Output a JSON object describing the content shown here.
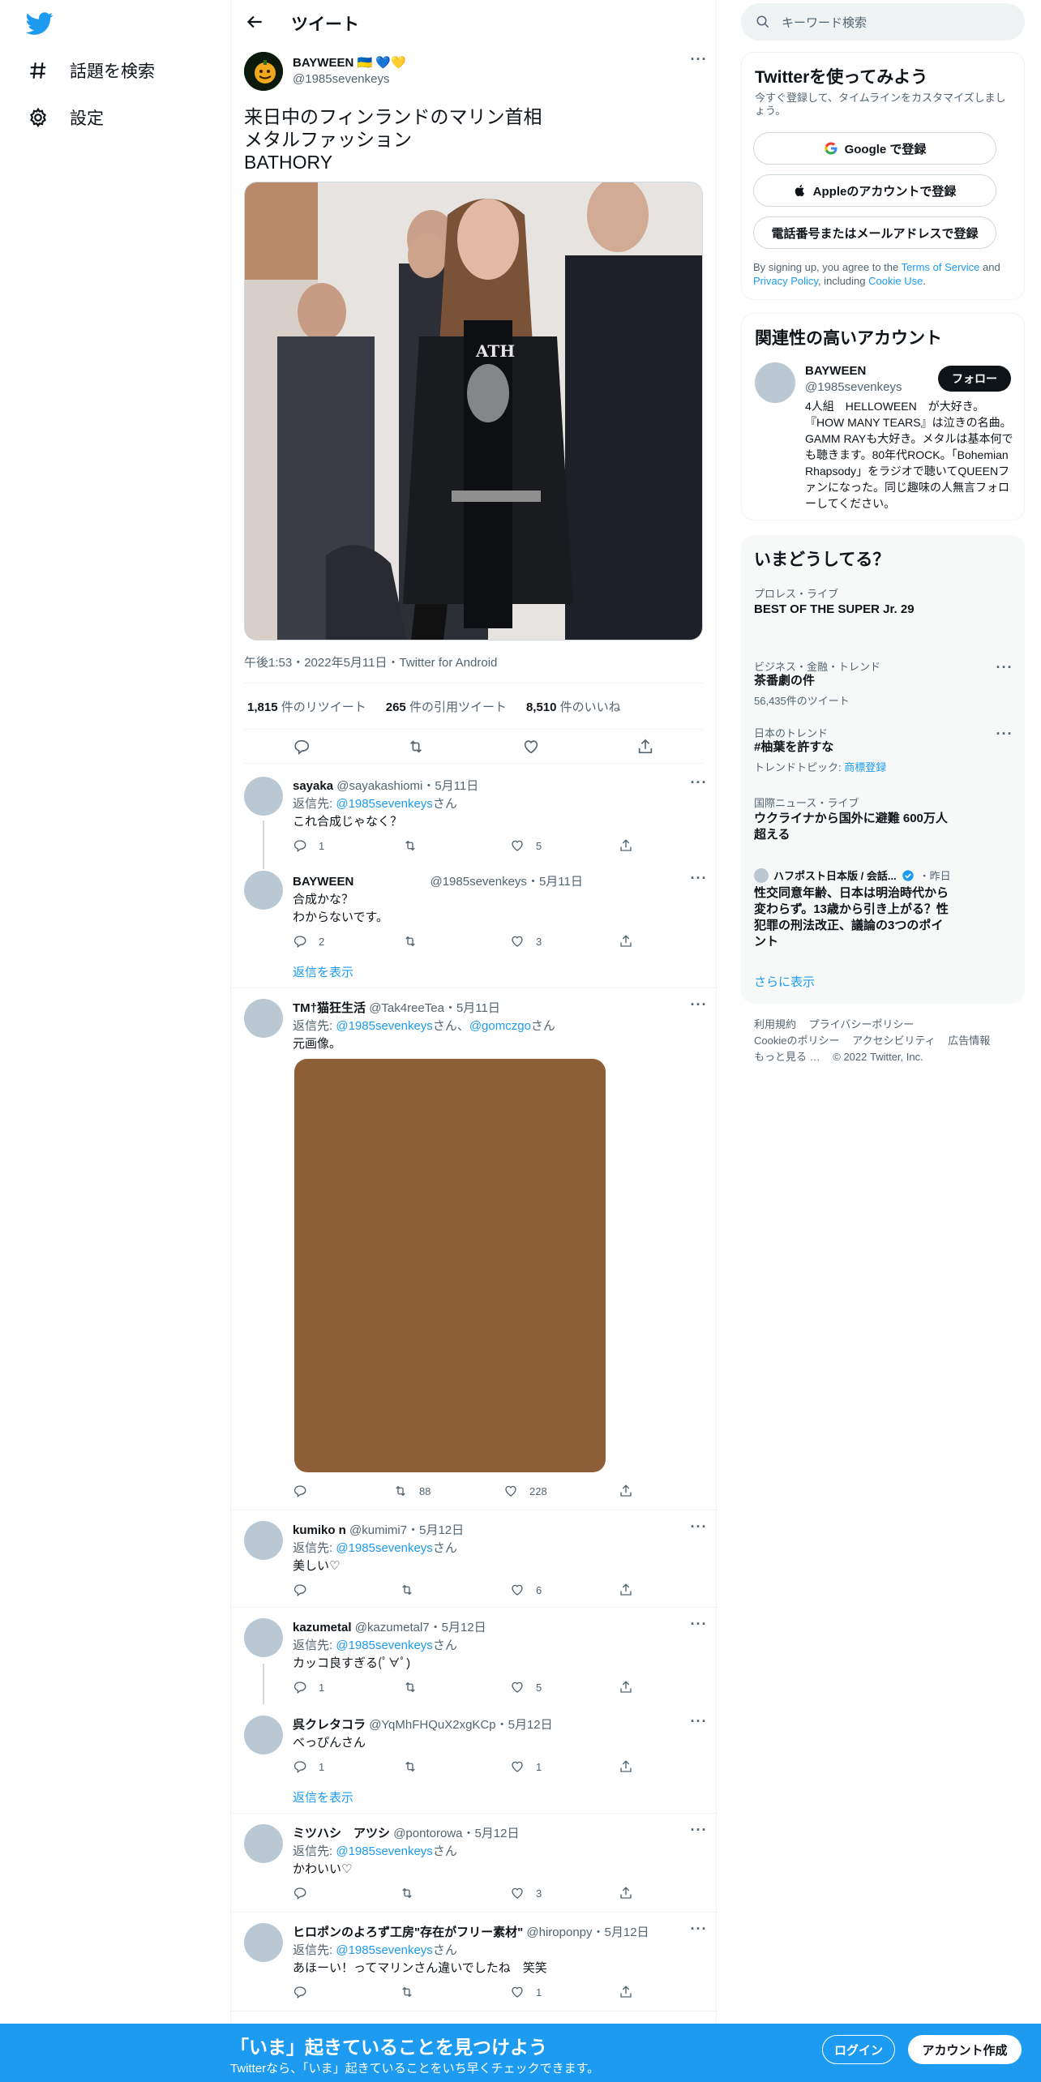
{
  "nav": {
    "explore_label": "話題を検索",
    "settings_label": "設定"
  },
  "header": {
    "title": "ツイート"
  },
  "main_tweet": {
    "author_name": "BAYWEEN 🇺🇦 💙💛",
    "author_handle": "@1985sevenkeys",
    "text": "来日中のフィンランドのマリン首相\nメタルファッション\nBATHORY",
    "meta": "午後1:53・2022年5月11日・Twitter for Android",
    "retweets": "1,815",
    "retweets_label": "件のリツイート",
    "quotes": "265",
    "quotes_label": "件の引用ツイート",
    "likes": "8,510",
    "likes_label": "件のいいね"
  },
  "replies": [
    {
      "name": "sayaka",
      "handle": "@sayakashiomi",
      "date": "・5月11日",
      "reply_to_label": "返信先: ",
      "reply_to": "@1985sevenkeys",
      "reply_suffix": "さん",
      "text": "これ合成じゃなく？",
      "reply_count": "1",
      "retweet_count": "",
      "like_count": "5"
    },
    {
      "name": "BAYWEEN",
      "handle": "@1985sevenkeys",
      "date": "・5月11日",
      "text1": "合成かな？",
      "text2": "わからないです。",
      "reply_count": "2",
      "retweet_count": "",
      "like_count": "3"
    },
    {
      "name": "TM†猫狂生活",
      "handle": "@Tak4reeTea",
      "date": "・5月11日",
      "reply_to_label": "返信先: ",
      "reply_to": "@1985sevenkeys",
      "reply_mid": "さん、",
      "reply_to2": "@gomczgo",
      "reply_suffix": "さん",
      "text": "元画像。",
      "reply_count": "",
      "retweet_count": "88",
      "like_count": "228"
    },
    {
      "name": "kumiko n",
      "handle": "@kumimi7",
      "date": "・5月12日",
      "reply_to_label": "返信先: ",
      "reply_to": "@1985sevenkeys",
      "reply_suffix": "さん",
      "text": "美しい♡",
      "reply_count": "",
      "retweet_count": "",
      "like_count": "6"
    },
    {
      "name": "kazumetal",
      "handle": "@kazumetal7",
      "date": "・5月12日",
      "reply_to_label": "返信先: ",
      "reply_to": "@1985sevenkeys",
      "reply_suffix": "さん",
      "text": "カッコ良すぎる(ﾟ∀ﾟ)",
      "reply_count": "1",
      "retweet_count": "",
      "like_count": "5"
    },
    {
      "name": "呉クレタコラ",
      "handle": "@YqMhFHQuX2xgKCp",
      "date": "・5月12日",
      "text": "べっぴんさん",
      "reply_count": "1",
      "retweet_count": "",
      "like_count": "1"
    },
    {
      "name": "ミツハシ　アツシ",
      "handle": "@pontorowa",
      "date": "・5月12日",
      "reply_to_label": "返信先: ",
      "reply_to": "@1985sevenkeys",
      "reply_suffix": "さん",
      "text": "かわいい♡",
      "reply_count": "",
      "retweet_count": "",
      "like_count": "3"
    },
    {
      "name": "ヒロポンのよろず工房\"存在がフリー素材\"",
      "handle": "@hiroponpy",
      "date": "・5月12日",
      "reply_to_label": "返信先: ",
      "reply_to": "@1985sevenkeys",
      "reply_suffix": "さん",
      "text": "あほーい！ってマリンさん違いでしたね　笑笑",
      "reply_count": "",
      "retweet_count": "",
      "like_count": "1"
    }
  ],
  "show_replies_label": "返信を表示",
  "right": {
    "search_placeholder": "キーワード検索",
    "signup": {
      "title": "Twitterを使ってみよう",
      "sub": "今すぐ登録して、タイムラインをカスタマイズしましょう。",
      "google": "Google で登録",
      "apple": "Appleのアカウントで登録",
      "phone": "電話番号またはメールアドレスで登録",
      "legal_1": "By signing up, you agree to the ",
      "terms": "Terms of Service",
      "legal_2": " and ",
      "privacy": "Privacy Policy",
      "legal_3": ", including ",
      "cookie": "Cookie Use",
      "legal_4": "."
    },
    "related": {
      "title": "関連性の高いアカウント",
      "name": "BAYWEEN",
      "handle": "@1985sevenkeys",
      "follow": "フォロー",
      "bio": "4人組　HELLOWEEN　が大好き。『HOW MANY TEARS』は泣きの名曲。GAMM RAYも大好き。メタルは基本何でも聴きます。80年代ROCK。「Bohemian Rhapsody」をラジオで聴いてQUEENファンになった。同じ趣味の人無言フォローしてください。"
    },
    "trends": {
      "title": "いまどうしてる？",
      "items": [
        {
          "cat": "プロレス・ライブ",
          "title": "BEST OF THE SUPER Jr. 29"
        },
        {
          "cat": "ビジネス・金融・トレンド",
          "title": "茶番劇の件",
          "sub": "56,435件のツイート"
        },
        {
          "cat": "日本のトレンド",
          "title": "#柚葉を許すな",
          "sub_label": "トレンドトピック: ",
          "sub_link": "商標登録"
        },
        {
          "cat": "国際ニュース・ライブ",
          "title": "ウクライナから国外に避難 600万人超える"
        },
        {
          "cat_name": "ハフポスト日本版 / 会話...",
          "cat_time": "・昨日",
          "title": "性交同意年齢、日本は明治時代から変わらず。13歳から引き上がる？性犯罪の刑法改正、議論の3つのポイント"
        }
      ],
      "more": "さらに表示"
    },
    "footer": {
      "links": [
        "利用規約",
        "プライバシーポリシー",
        "Cookieのポリシー",
        "アクセシビリティ",
        "広告情報",
        "もっと見る …"
      ],
      "copyright": "© 2022 Twitter, Inc."
    }
  },
  "banner": {
    "title": "「いま」起きていることを見つけよう",
    "sub": "Twitterなら、「いま」起きていることをいち早くチェックできます。",
    "login": "ログイン",
    "signup": "アカウント作成"
  },
  "colors": {
    "accent": "#1d9bf0",
    "text": "#0f1419",
    "muted": "#536471",
    "placeholder_image": "#8e5f37"
  }
}
